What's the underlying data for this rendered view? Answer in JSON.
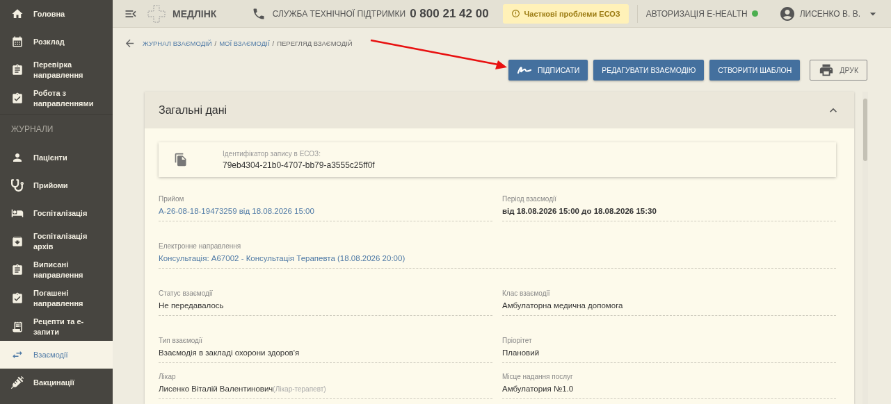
{
  "sidebar": {
    "items": [
      {
        "label": "Головна",
        "selected": false
      },
      {
        "label": "Розклад",
        "selected": false
      },
      {
        "label": "Перевірка направлення",
        "selected": false
      },
      {
        "label": "Робота з направленнями",
        "selected": false
      }
    ],
    "section_title": "ЖУРНАЛИ",
    "journal_items": [
      {
        "label": "Пацієнти",
        "selected": false
      },
      {
        "label": "Прийоми",
        "selected": false
      },
      {
        "label": "Госпіталізація",
        "selected": false
      },
      {
        "label": "Госпіталізація архів",
        "selected": false
      },
      {
        "label": "Виписані направлення",
        "selected": false
      },
      {
        "label": "Погашені направлення",
        "selected": false
      },
      {
        "label": "Рецепти та е-запити",
        "selected": false
      },
      {
        "label": "Взаємодії",
        "selected": true
      },
      {
        "label": "Вакцинації",
        "selected": false
      }
    ]
  },
  "header": {
    "logo": "МЕДЛІНК",
    "support_label": "СЛУЖБА ТЕХНІЧНОЇ ПІДТРИМКИ",
    "support_phone": "0 800 21 42 00",
    "warning": "Часткові проблеми ЕСОЗ",
    "auth": {
      "label": "АВТОРИЗАЦІЯ E-HEALTH",
      "color": "#4caf50"
    },
    "user": "ЛИСЕНКО В. В."
  },
  "breadcrumbs": [
    {
      "label": "ЖУРНАЛ ВЗАЄМОДІЙ",
      "kind": "link"
    },
    {
      "separator": "/",
      "label": "МОЇ ВЗАЄМОДІЇ",
      "kind": "link"
    },
    {
      "separator": "/",
      "label": "ПЕРЕГЛЯД ВЗАЄМОДІЙ",
      "kind": "current"
    }
  ],
  "actions": [
    {
      "label": "ПІДПИСАТИ",
      "kind": "sign"
    },
    {
      "label": "РЕДАГУВАТИ ВЗАЄМОДІЮ",
      "kind": "primary"
    },
    {
      "label": "СТВОРИТИ ШАБЛОН",
      "kind": "primary"
    },
    {
      "label": "ДРУК",
      "kind": "print"
    }
  ],
  "card": {
    "title": "Загальні дані",
    "expanded": true,
    "record": {
      "label": "Ідентифікатор запису в ЕСОЗ:",
      "value": "79eb4304-21b0-4707-bb79-a3555c25ff0f"
    },
    "rows": [
      [
        {
          "label": "Прийом",
          "value": "А-26-08-18-19473259 від 18.08.2026 15:00",
          "kind": "link"
        },
        {
          "label": "Період взаємодії",
          "value": "від 18.08.2026 15:00 до 18.08.2026 15:30",
          "kind": "bold"
        }
      ],
      [
        {
          "label": "Електронне направлення",
          "value": "Консультація: А67002 - Консультація Терапевта (18.08.2026 20:00)",
          "kind": "link"
        }
      ],
      [
        {
          "label": "Статус взаємодії",
          "value": "Не передавалось",
          "kind": "plain"
        },
        {
          "label": "Клас взаємодії",
          "value": "Амбулаторна медична допомога",
          "kind": "plain"
        }
      ],
      [
        {
          "label": "Тип взаємодії",
          "value": "Взаємодія в закладі охорони здоров'я",
          "kind": "plain"
        },
        {
          "label": "Пріорітет",
          "value": "Плановий",
          "kind": "plain"
        }
      ],
      [
        {
          "label": "Лікар",
          "value": "Лисенко Віталій Валентинович",
          "note": "(Лікар-терапевт)",
          "kind": "plain"
        },
        {
          "label": "Місце надання послуг",
          "value": "Амбулатория №1.0",
          "kind": "plain"
        }
      ]
    ]
  }
}
